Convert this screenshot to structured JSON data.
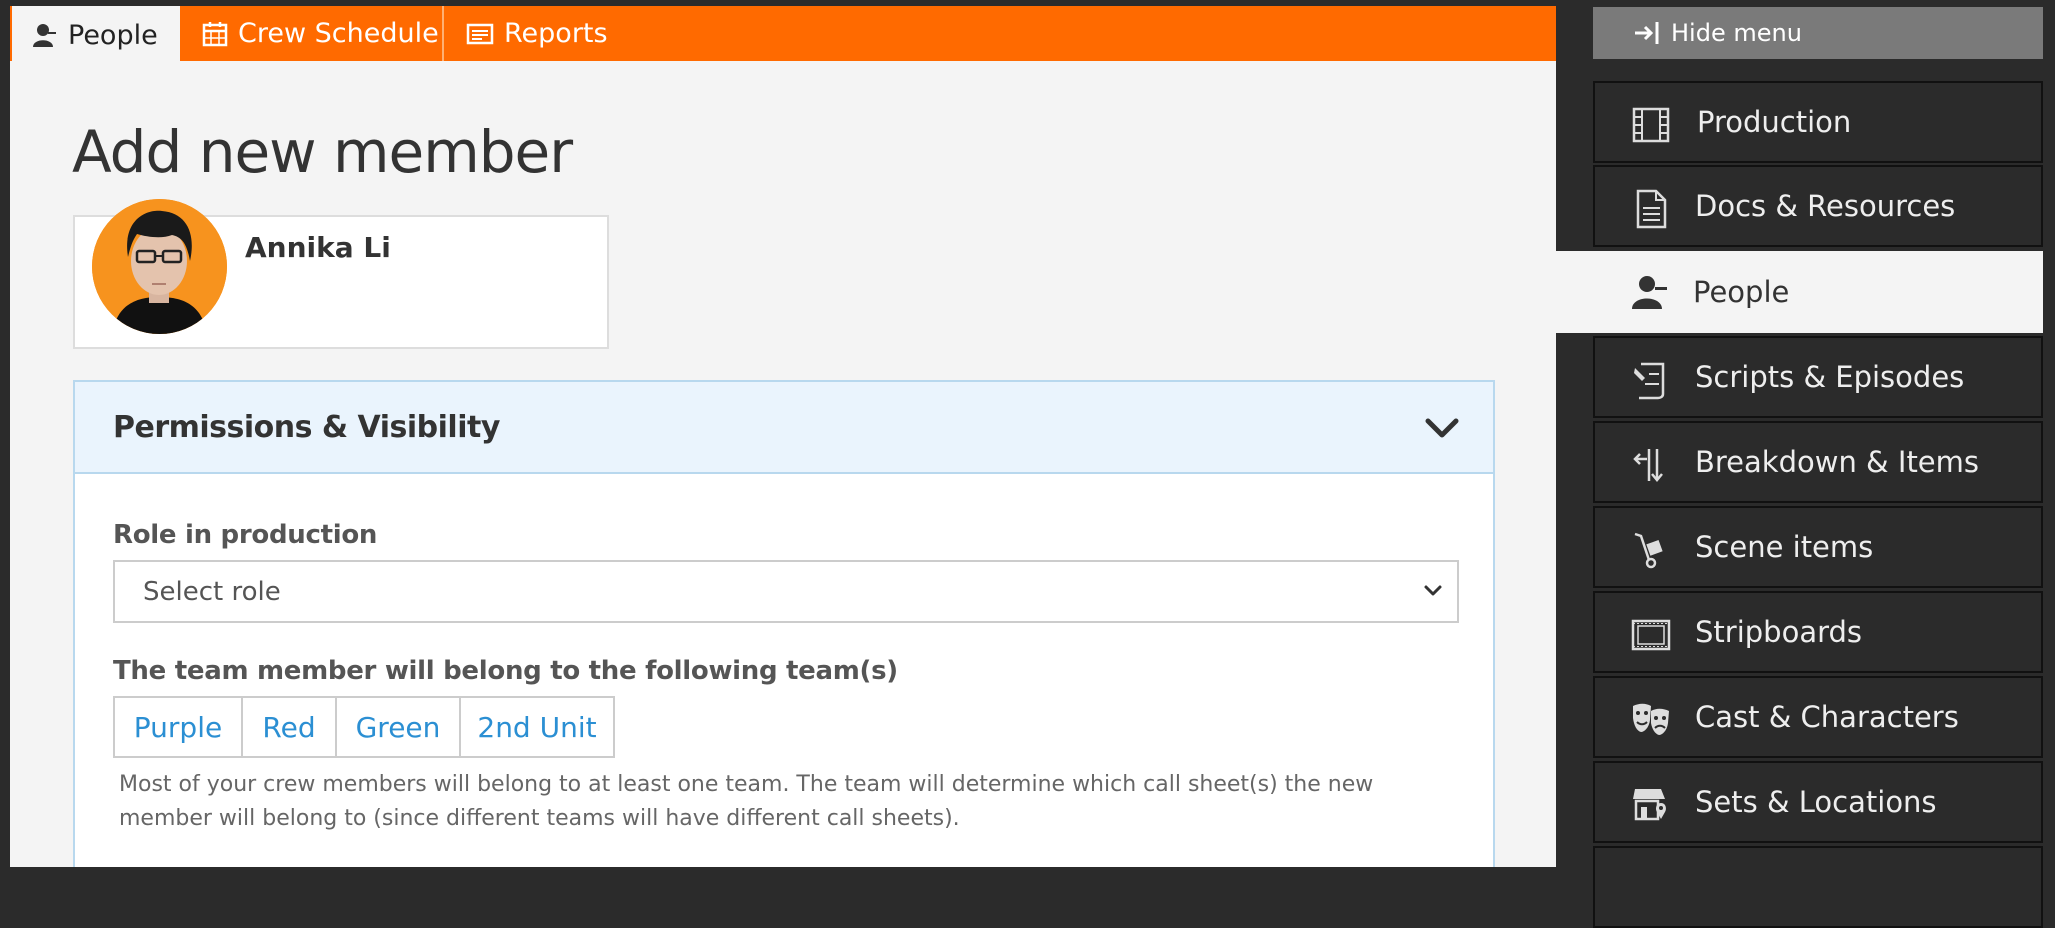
{
  "tabs": [
    {
      "label": "People",
      "icon": "person-icon",
      "active": true
    },
    {
      "label": "Crew Schedule",
      "icon": "calendar-icon",
      "active": false
    },
    {
      "label": "Reports",
      "icon": "report-icon",
      "active": false
    }
  ],
  "page": {
    "title": "Add new member"
  },
  "member": {
    "name": "Annika Li"
  },
  "permissions": {
    "title": "Permissions & Visibility",
    "role_label": "Role in production",
    "role_value": "Select role",
    "teams_label": "The team member will belong to the following team(s)",
    "teams": [
      "Purple",
      "Red",
      "Green",
      "2nd Unit"
    ],
    "teams_help": "Most of your crew members will belong to at least one team. The team will determine which call sheet(s) the new member will belong to (since different teams will have different call sheets)."
  },
  "sidebar": {
    "hide_label": "Hide menu",
    "items": [
      {
        "label": "Production",
        "icon": "film-icon"
      },
      {
        "label": "Docs & Resources",
        "icon": "document-icon"
      },
      {
        "label": "People",
        "icon": "people-icon",
        "active": true
      },
      {
        "label": "Scripts & Episodes",
        "icon": "script-icon"
      },
      {
        "label": "Breakdown & Items",
        "icon": "breakdown-icon"
      },
      {
        "label": "Scene items",
        "icon": "hand-truck-icon"
      },
      {
        "label": "Stripboards",
        "icon": "stripboard-icon"
      },
      {
        "label": "Cast & Characters",
        "icon": "theater-masks-icon"
      },
      {
        "label": "Sets & Locations",
        "icon": "store-location-icon"
      }
    ]
  },
  "colors": {
    "accent": "#ff6a00",
    "link": "#2b8fd3",
    "panel_header": "#eaf4fd",
    "sidebar_bg": "#2b2b2b"
  }
}
